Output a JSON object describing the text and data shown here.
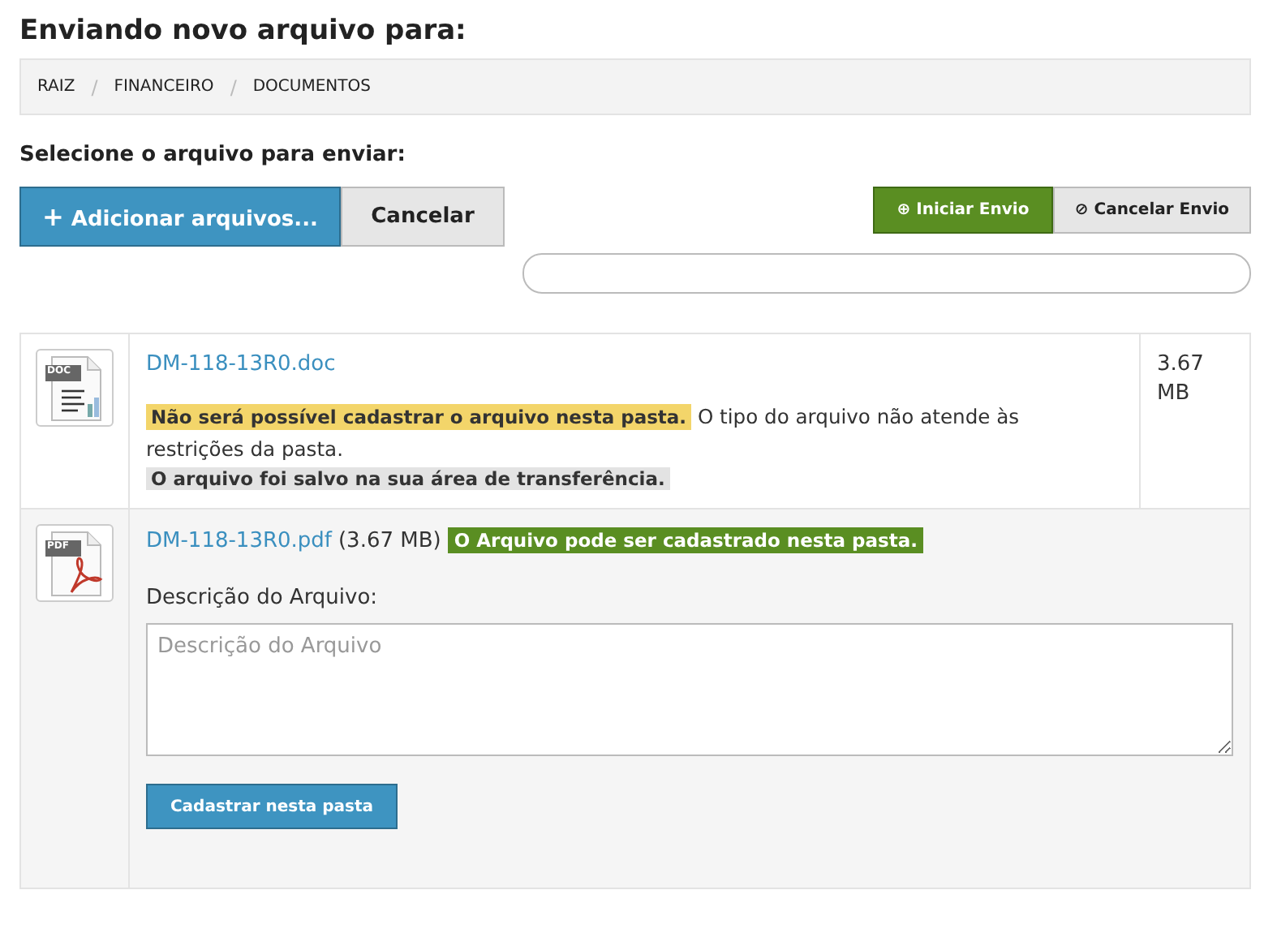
{
  "title": "Enviando novo arquivo para:",
  "breadcrumb": [
    "RAIZ",
    "FINANCEIRO",
    "DOCUMENTOS"
  ],
  "breadcrumb_separator": "/",
  "section_label": "Selecione o arquivo para enviar:",
  "add_button": {
    "icon": "+",
    "label": "Adicionar arquivos..."
  },
  "cancel_button": "Cancelar",
  "start_button": {
    "icon": "⊕",
    "label": "Iniciar Envio"
  },
  "stop_button": {
    "icon": "⊘",
    "label": "Cancelar Envio"
  },
  "progress": {
    "level": 0
  },
  "files": [
    {
      "kind": "rejected",
      "badge": "DOC",
      "name": "DM-118-13R0.doc",
      "size": "3.67 MB",
      "status": "Não será possível cadastrar o arquivo nesta pasta.",
      "message": "O tipo do arquivo não atende às restrições da pasta.",
      "note": "O arquivo foi salvo na sua área de transferência."
    },
    {
      "kind": "accepted",
      "badge": "PDF",
      "name": "DM-118-13R0.pdf",
      "size": "(3.67 MB)",
      "status": "O Arquivo pode ser cadastrado nesta pasta.",
      "description_label": "Descrição do Arquivo:",
      "description_placeholder": "Descrição do Arquivo",
      "submit": "Cadastrar nesta pasta"
    }
  ]
}
